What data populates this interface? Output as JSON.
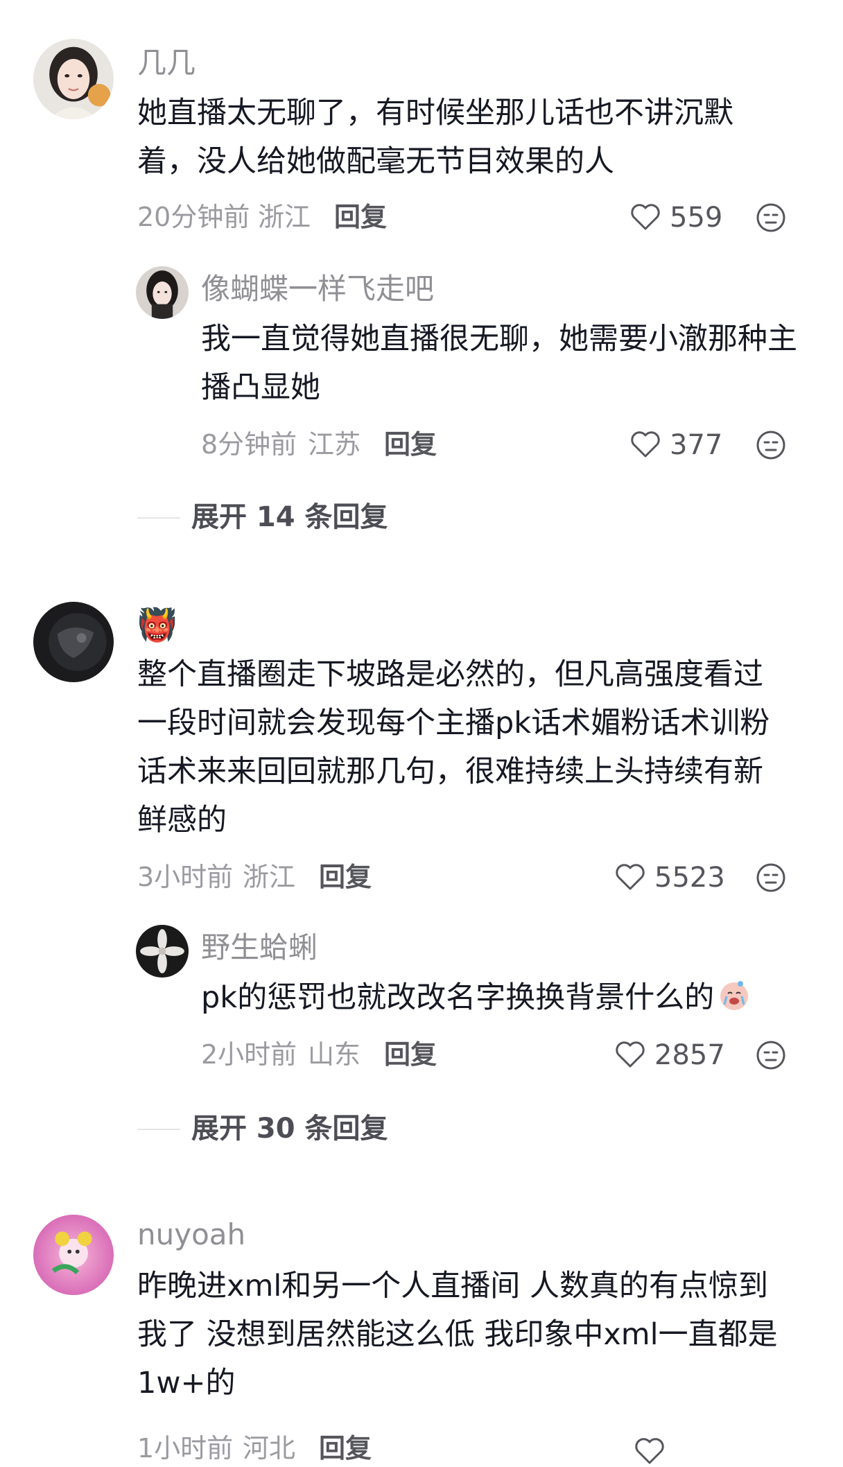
{
  "comments": [
    {
      "username": "几几",
      "text": "她直播太无聊了，有时候坐那儿话也不讲沉默着，没人给她做配毫无节目效果的人",
      "time": "20分钟前",
      "location": "浙江",
      "reply_label": "回复",
      "likes": "559",
      "avatar_icon": "avatar-girl-photo",
      "replies": [
        {
          "username": "像蝴蝶一样飞走吧",
          "text": "我一直觉得她直播很无聊，她需要小澈那种主播凸显她",
          "time": "8分钟前",
          "location": "江苏",
          "reply_label": "回复",
          "likes": "377",
          "avatar_icon": "avatar-selfie-photo"
        }
      ],
      "expand_label": "展开 14 条回复"
    },
    {
      "username": "👹",
      "text": "整个直播圈走下坡路是必然的，但凡高强度看过一段时间就会发现每个主播pk话术媚粉话术训粉话术来来回回就那几句，很难持续上头持续有新鲜感的",
      "time": "3小时前",
      "location": "浙江",
      "reply_label": "回复",
      "likes": "5523",
      "avatar_icon": "avatar-dark-photo",
      "replies": [
        {
          "username": "野生蛤蜊",
          "text": "pk的惩罚也就改改名字换换背景什么的",
          "emoji": "crying-face-emoji",
          "time": "2小时前",
          "location": "山东",
          "reply_label": "回复",
          "likes": "2857",
          "avatar_icon": "avatar-flower-photo"
        }
      ],
      "expand_label": "展开 30 条回复"
    },
    {
      "username": "nuyoah",
      "text": "昨晚进xml和另一个人直播间 人数真的有点惊到我了 没想到居然能这么低 我印象中xml一直都是1w+的",
      "time": "1小时前",
      "location": "河北",
      "reply_label": "回复",
      "avatar_icon": "avatar-pink-cartoon"
    }
  ],
  "colors": {
    "text": "#161823",
    "meta": "#9a9aa0",
    "username": "#8f8f94"
  }
}
